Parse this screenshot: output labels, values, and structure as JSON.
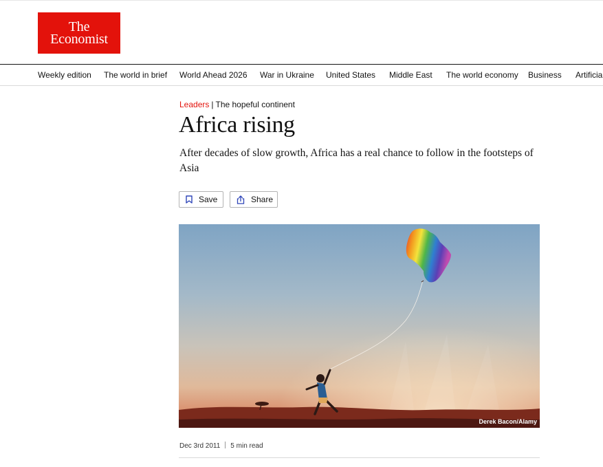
{
  "brand": {
    "logo_line1": "The",
    "logo_line2": "Economist",
    "color": "#e3120b"
  },
  "nav": {
    "items": [
      {
        "label": "Weekly edition"
      },
      {
        "label": "The world in brief"
      },
      {
        "label": "World Ahead 2026"
      },
      {
        "label": "War in Ukraine"
      },
      {
        "label": "United States"
      },
      {
        "label": "Middle East"
      },
      {
        "label": "The world economy"
      },
      {
        "label": "Business"
      },
      {
        "label": "Artificia"
      }
    ]
  },
  "article": {
    "section": "Leaders",
    "separator": "|",
    "flytitle": "The hopeful continent",
    "headline": "Africa rising",
    "rubric": "After decades of slow growth, Africa has a real chance to follow in the footsteps of Asia",
    "actions": {
      "save_label": "Save",
      "save_icon": "bookmark-icon",
      "share_label": "Share",
      "share_icon": "share-icon"
    },
    "image": {
      "description_icon": "africa-kite-photo",
      "credit": "Derek Bacon/Alamy"
    },
    "date": "Dec 3rd 2011",
    "read_time": "5 min read"
  },
  "colors": {
    "accent_red": "#e3120b",
    "text": "#121212",
    "icon_blue": "#2e45b8"
  }
}
